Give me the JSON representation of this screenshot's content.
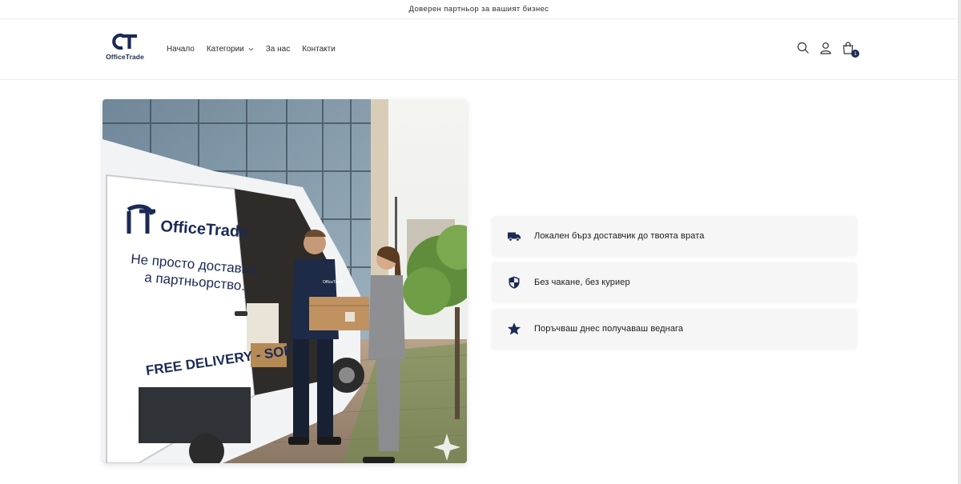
{
  "announcement": {
    "text": "Доверен партньор за вашият бизнес"
  },
  "brand": {
    "name": "OfficeTrade",
    "mark": "CT",
    "color": "#1b2a55"
  },
  "nav": {
    "items": [
      {
        "label": "Начало"
      },
      {
        "label": "Категории",
        "has_dropdown": true
      },
      {
        "label": "За нас"
      },
      {
        "label": "Контакти"
      }
    ]
  },
  "header_icons": {
    "search": "search-icon",
    "account": "user-icon",
    "cart": "shopping-bag-icon",
    "cart_count": "1"
  },
  "hero": {
    "van_brand": "OfficeTrade",
    "van_tagline_1": "Не просто доставка,",
    "van_tagline_2": "а партньорство.",
    "van_delivery": "FREE DELIVERY - SOFIA",
    "shirt_brand": "OfficeTrade"
  },
  "features": [
    {
      "icon": "truck-icon",
      "text": "Локален бърз доставчик до твоята врата"
    },
    {
      "icon": "shield-icon",
      "text": "Без чакане, без куриер"
    },
    {
      "icon": "star-icon",
      "text": "Поръчваш днес получаваш веднага"
    }
  ]
}
